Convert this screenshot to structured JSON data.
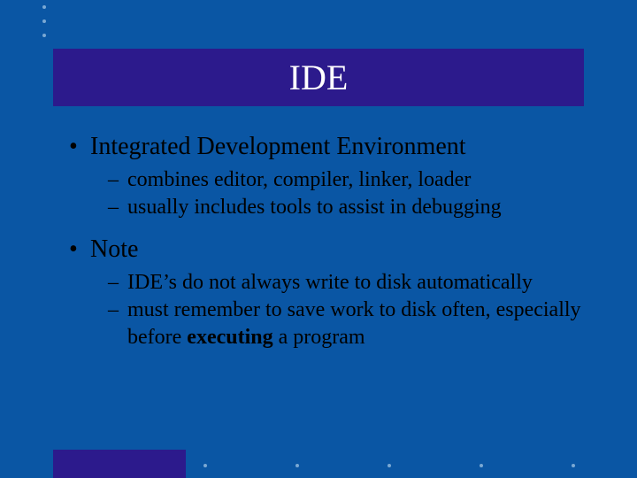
{
  "title": "IDE",
  "bullets": [
    {
      "text": "Integrated Development Environment",
      "sub": [
        {
          "text": "combines editor, compiler, linker, loader"
        },
        {
          "text": "usually includes tools to assist in debugging"
        }
      ]
    },
    {
      "text": "Note",
      "sub": [
        {
          "text": "IDE’s do not always write to disk automatically"
        },
        {
          "prefix": "must remember to save work to disk often, especially before ",
          "bold": "executing",
          "suffix": " a program"
        }
      ]
    }
  ]
}
